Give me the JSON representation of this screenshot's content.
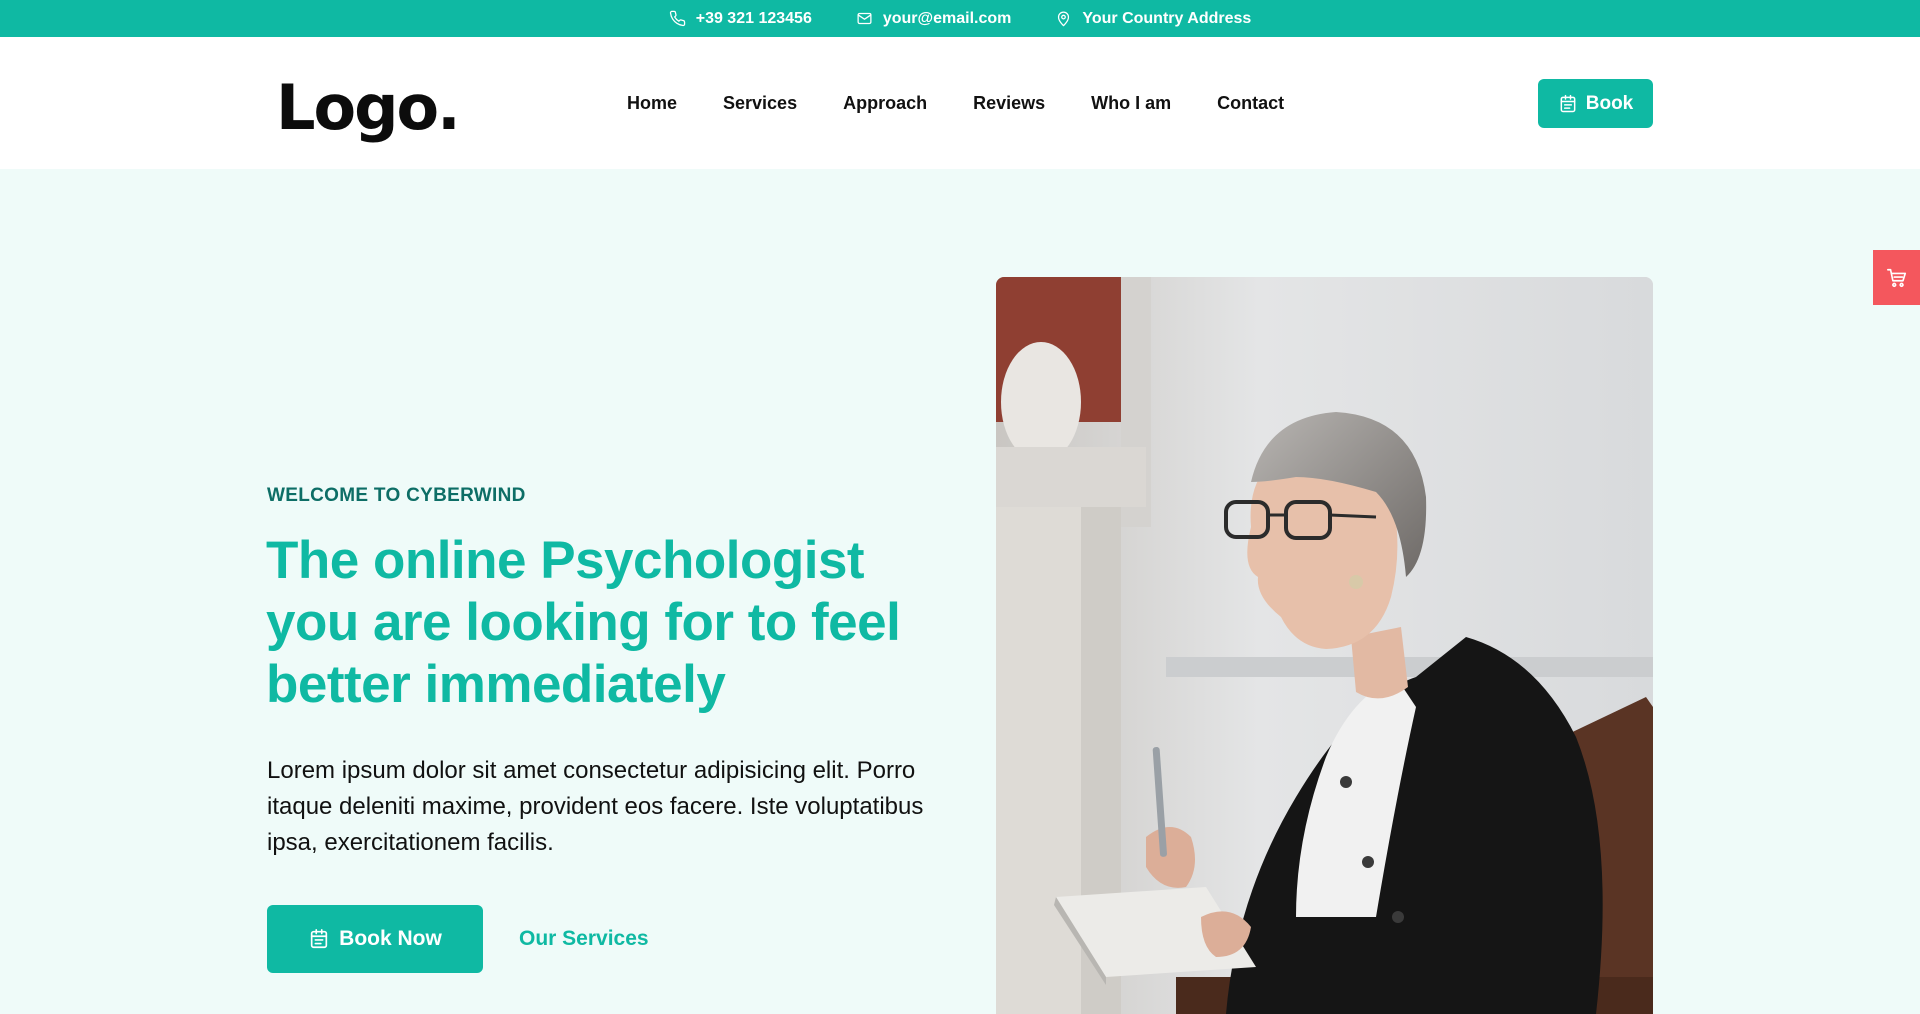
{
  "topbar": {
    "phone": "+39 321 123456",
    "email": "your@email.com",
    "address": "Your Country Address",
    "phone_icon": "phone-icon",
    "email_icon": "mail-icon",
    "address_icon": "map-pin-icon"
  },
  "header": {
    "logo": "Logo.",
    "nav": [
      "Home",
      "Services",
      "Approach",
      "Reviews",
      "Who I am",
      "Contact"
    ],
    "book_label": "Book",
    "book_icon": "calendar-icon"
  },
  "cart": {
    "icon": "cart-icon"
  },
  "hero": {
    "eyebrow": "WELCOME TO CYBERWIND",
    "title": "The online Psychologist you are looking for to feel better immediately",
    "text": "Lorem ipsum dolor sit amet consectetur adipisicing elit. Porro itaque deleniti maxime, provident eos facere. Iste voluptatibus ipsa, exercitationem facilis.",
    "cta_label": "Book Now",
    "cta_icon": "calendar-icon",
    "secondary_label": "Our Services"
  },
  "colors": {
    "accent": "#0fb9a3",
    "accent_dark": "#0d6e66",
    "hero_bg": "#effbf9",
    "cart_tab": "#f4575d"
  }
}
